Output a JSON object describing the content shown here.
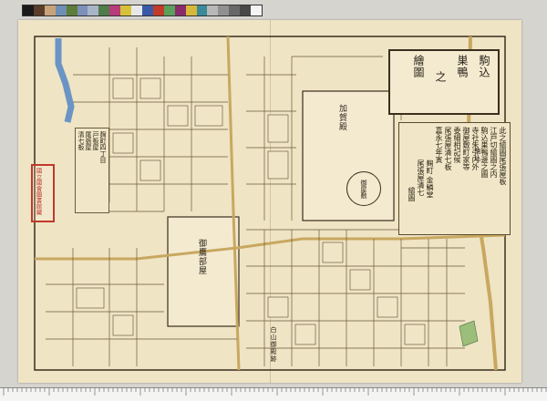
{
  "calibration_strip": {
    "colors": [
      "#1a1a1a",
      "#5a3d2a",
      "#c9a27a",
      "#6d8fb4",
      "#5e7d3a",
      "#7e8fb8",
      "#a8b4c8",
      "#4f7c4a",
      "#b83b7a",
      "#d6c23a",
      "#e8e8e8",
      "#3a5aa8",
      "#c23a2a",
      "#5aa05a",
      "#8a2a6a",
      "#d8b838",
      "#3a8a9a",
      "#b8b8b8",
      "#909090",
      "#686868",
      "#484848",
      "#f4f4f4"
    ]
  },
  "title": {
    "columns": [
      "駒込",
      "巣鴨",
      "之",
      "繪圖"
    ]
  },
  "notes": {
    "lines": [
      "此之繪圖尾張屋板",
      "江戸切繪圖之内",
      "駒込巣鴨邊之圖",
      "寺社朱引内外",
      "御屋敷町家等",
      "委細相記候",
      "尾張屋清七板",
      "嘉永七年寅",
      "麹町 金鱗堂",
      "尾張屋清七",
      "繪圖"
    ]
  },
  "publisher": {
    "lines": [
      "麹町四丁目",
      "戸板屋",
      "尾張屋",
      "清七板"
    ]
  },
  "stamp": {
    "text": "國立國會圖書館藏"
  },
  "labels": {
    "center_left": "御鷹部屋",
    "center_top": "加賀殿",
    "seal": "御屋敷",
    "top_right": "駒込",
    "bottom_mid": "白山御殿跡"
  }
}
